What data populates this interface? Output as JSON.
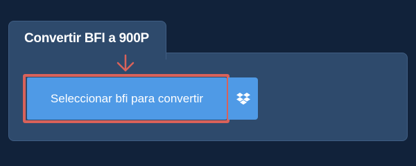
{
  "converter": {
    "tab_title": "Convertir BFI a 900P",
    "select_button_label": "Seleccionar bfi para convertir",
    "dropbox_icon": "dropbox-icon",
    "arrow_icon": "arrow-down-icon"
  },
  "colors": {
    "background": "#11223a",
    "panel": "#2e4a6c",
    "button": "#4f9ae6",
    "highlight": "#d9625a",
    "text": "#ffffff"
  }
}
